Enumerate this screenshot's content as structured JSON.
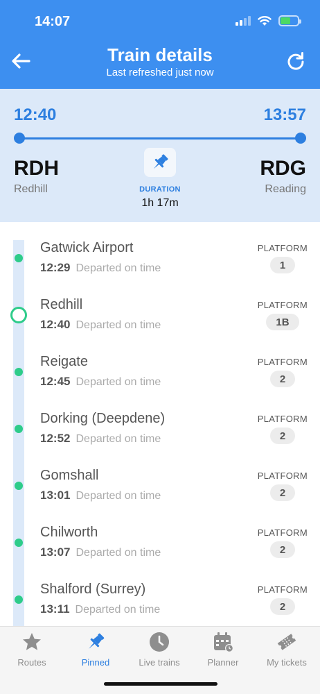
{
  "status_bar": {
    "time": "14:07"
  },
  "header": {
    "title": "Train details",
    "subtitle": "Last refreshed just now",
    "back_icon": "arrow-left-icon",
    "refresh_icon": "refresh-icon"
  },
  "journey": {
    "departure_time": "12:40",
    "arrival_time": "13:57",
    "origin_code": "RDH",
    "origin_name": "Redhill",
    "destination_code": "RDG",
    "destination_name": "Reading",
    "duration_label": "DURATION",
    "duration": "1h 17m",
    "pin_icon": "pin-icon"
  },
  "platform_label": "PLATFORM",
  "stops": [
    {
      "name": "Gatwick Airport",
      "time": "12:29",
      "status": "Departed on time",
      "platform": "1",
      "current": false
    },
    {
      "name": "Redhill",
      "time": "12:40",
      "status": "Departed on time",
      "platform": "1B",
      "current": true
    },
    {
      "name": "Reigate",
      "time": "12:45",
      "status": "Departed on time",
      "platform": "2",
      "current": false
    },
    {
      "name": "Dorking (Deepdene)",
      "time": "12:52",
      "status": "Departed on time",
      "platform": "2",
      "current": false
    },
    {
      "name": "Gomshall",
      "time": "13:01",
      "status": "Departed on time",
      "platform": "2",
      "current": false
    },
    {
      "name": "Chilworth",
      "time": "13:07",
      "status": "Departed on time",
      "platform": "2",
      "current": false
    },
    {
      "name": "Shalford (Surrey)",
      "time": "13:11",
      "status": "Departed on time",
      "platform": "2",
      "current": false
    }
  ],
  "tabs": [
    {
      "label": "Routes",
      "icon": "star-icon",
      "active": false
    },
    {
      "label": "Pinned",
      "icon": "pin-icon",
      "active": true
    },
    {
      "label": "Live trains",
      "icon": "clock-icon",
      "active": false
    },
    {
      "label": "Planner",
      "icon": "calendar-icon",
      "active": false
    },
    {
      "label": "My tickets",
      "icon": "ticket-icon",
      "active": false
    }
  ],
  "colors": {
    "header_bg": "#3d8ff0",
    "accent": "#2d7fe0",
    "summary_bg": "#dce9f9",
    "on_time_green": "#2ecc8a"
  }
}
